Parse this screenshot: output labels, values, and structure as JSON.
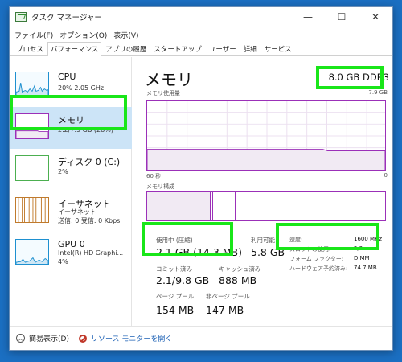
{
  "window": {
    "title": "タスク マネージャー"
  },
  "menu": [
    "ファイル(F)",
    "オプション(O)",
    "表示(V)"
  ],
  "tabs": [
    "プロセス",
    "パフォーマンス",
    "アプリの履歴",
    "スタートアップ",
    "ユーザー",
    "詳細",
    "サービス"
  ],
  "active_tab": "パフォーマンス",
  "sidebar": [
    {
      "title": "CPU",
      "lines": [
        "20% 2.05 GHz"
      ],
      "color": "#1e90d0"
    },
    {
      "title": "メモリ",
      "lines": [
        "2.2/7.9 GB (28%)"
      ],
      "color": "#9b30b8",
      "selected": true
    },
    {
      "title": "ディスク 0 (C:)",
      "lines": [
        "2%"
      ],
      "color": "#4caf50"
    },
    {
      "title": "イーサネット",
      "lines": [
        "イーサネット",
        "送信: 0 受信: 0 Kbps"
      ],
      "color": "#c07a2c"
    },
    {
      "title": "GPU 0",
      "lines": [
        "Intel(R) HD Graphi...",
        "4%"
      ],
      "color": "#1e90d0"
    }
  ],
  "main": {
    "title": "メモリ",
    "spec": "8.0 GB DDR3",
    "usage_label": "メモリ使用量",
    "usage_max": "7.9 GB",
    "time_left": "60 秒",
    "time_right": "0",
    "composition_label": "メモリ構成",
    "stats": {
      "in_use_label": "使用中 (圧縮)",
      "in_use_value": "2.1 GB (14.3 MB)",
      "available_label": "利用可能",
      "available_value": "5.8 GB",
      "committed_label": "コミット済み",
      "committed_value": "2.1/9.8 GB",
      "cached_label": "キャッシュ済み",
      "cached_value": "888 MB",
      "paged_label": "ページ プール",
      "paged_value": "154 MB",
      "nonpaged_label": "非ページ プール",
      "nonpaged_value": "147 MB"
    },
    "details": [
      {
        "label": "速度:",
        "value": "1600 MHz"
      },
      {
        "label": "スロットの使用:",
        "value": "2/2"
      },
      {
        "label": "フォーム ファクター:",
        "value": "DIMM"
      },
      {
        "label": "ハードウェア予約済み:",
        "value": "74.7 MB"
      }
    ]
  },
  "footer": {
    "fewer_details": "簡易表示(D)",
    "resource_monitor": "リソース モニターを開く"
  },
  "colors": {
    "highlight": "#19e619",
    "memory": "#9b30b8",
    "selected_bg": "#cce4f7"
  }
}
